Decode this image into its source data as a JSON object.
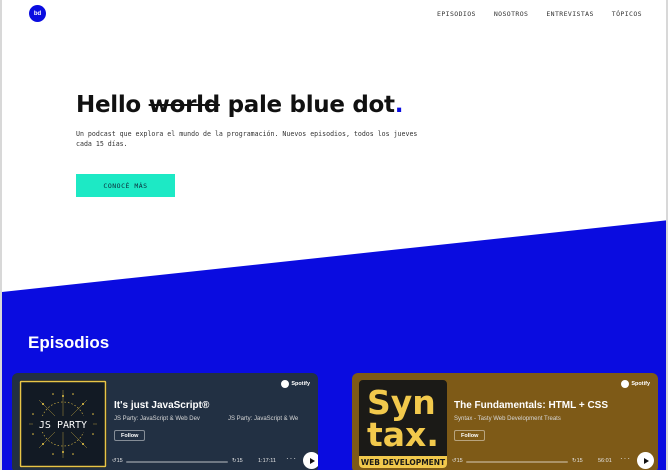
{
  "logo": {
    "text": "bd"
  },
  "nav": {
    "items": [
      "EPISODIOS",
      "NOSOTROS",
      "ENTREVISTAS",
      "TÓPICOS"
    ]
  },
  "hero": {
    "title_start": "Hello ",
    "title_strike": "world",
    "title_end": " pale blue dot",
    "title_dot": ".",
    "subtitle": "Un podcast que explora el mundo de la programación. Nuevos episodios, todos los jueves cada 15 días.",
    "cta_label": "CONOCÉ MÁS"
  },
  "episodes": {
    "title": "Episodios",
    "cards": [
      {
        "art_text": "JS PARTY",
        "title": "It's just JavaScript®",
        "subtitle": "JS Party: JavaScript & Web Dev",
        "subtitle_repeat": "JS Party: JavaScript & We",
        "follow": "Follow",
        "brand": "Spotify",
        "skip_back": "15",
        "skip_fwd": "15",
        "time": "1:17:11"
      },
      {
        "art_text_1": "Syn",
        "art_text_2": "tax.",
        "art_caption": "WEB DEVELOPMENT",
        "title": "The Fundamentals: HTML + CSS",
        "subtitle": "Syntax - Tasty Web Development Treats",
        "follow": "Follow",
        "brand": "Spotify",
        "skip_back": "15",
        "skip_fwd": "15",
        "time": "56:01"
      }
    ]
  },
  "colors": {
    "blue": "#0a0ce0",
    "cta": "#1de9c5",
    "card_dark": "#223043",
    "card_gold": "#7e5a17"
  }
}
